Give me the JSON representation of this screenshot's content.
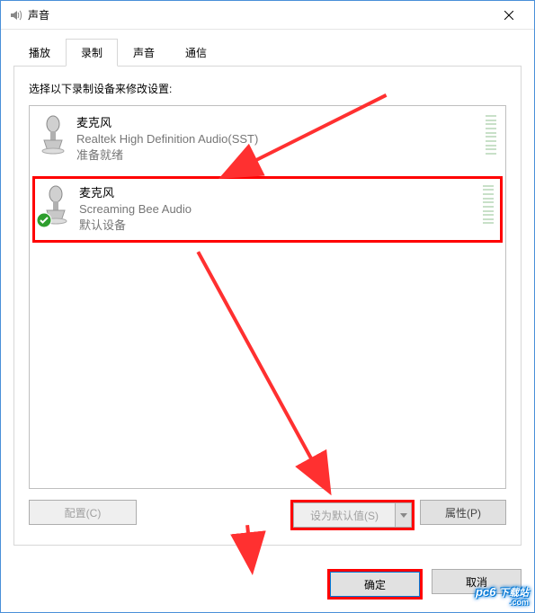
{
  "window": {
    "title": "声音"
  },
  "tabs": {
    "items": [
      {
        "label": "播放"
      },
      {
        "label": "录制"
      },
      {
        "label": "声音"
      },
      {
        "label": "通信"
      }
    ],
    "activeIndex": 1
  },
  "instruction": "选择以下录制设备来修改设置:",
  "devices": [
    {
      "name": "麦克风",
      "driver": "Realtek High Definition Audio(SST)",
      "status": "准备就绪",
      "default": false
    },
    {
      "name": "麦克风",
      "driver": "Screaming Bee Audio",
      "status": "默认设备",
      "default": true,
      "selected": true
    }
  ],
  "panelButtons": {
    "configure": "配置(C)",
    "setDefault": "设为默认值(S)",
    "properties": "属性(P)"
  },
  "footer": {
    "ok": "确定",
    "cancel": "取消"
  },
  "watermark": {
    "line1": "pc6",
    "line2": "下载站",
    "line3": ".com"
  }
}
